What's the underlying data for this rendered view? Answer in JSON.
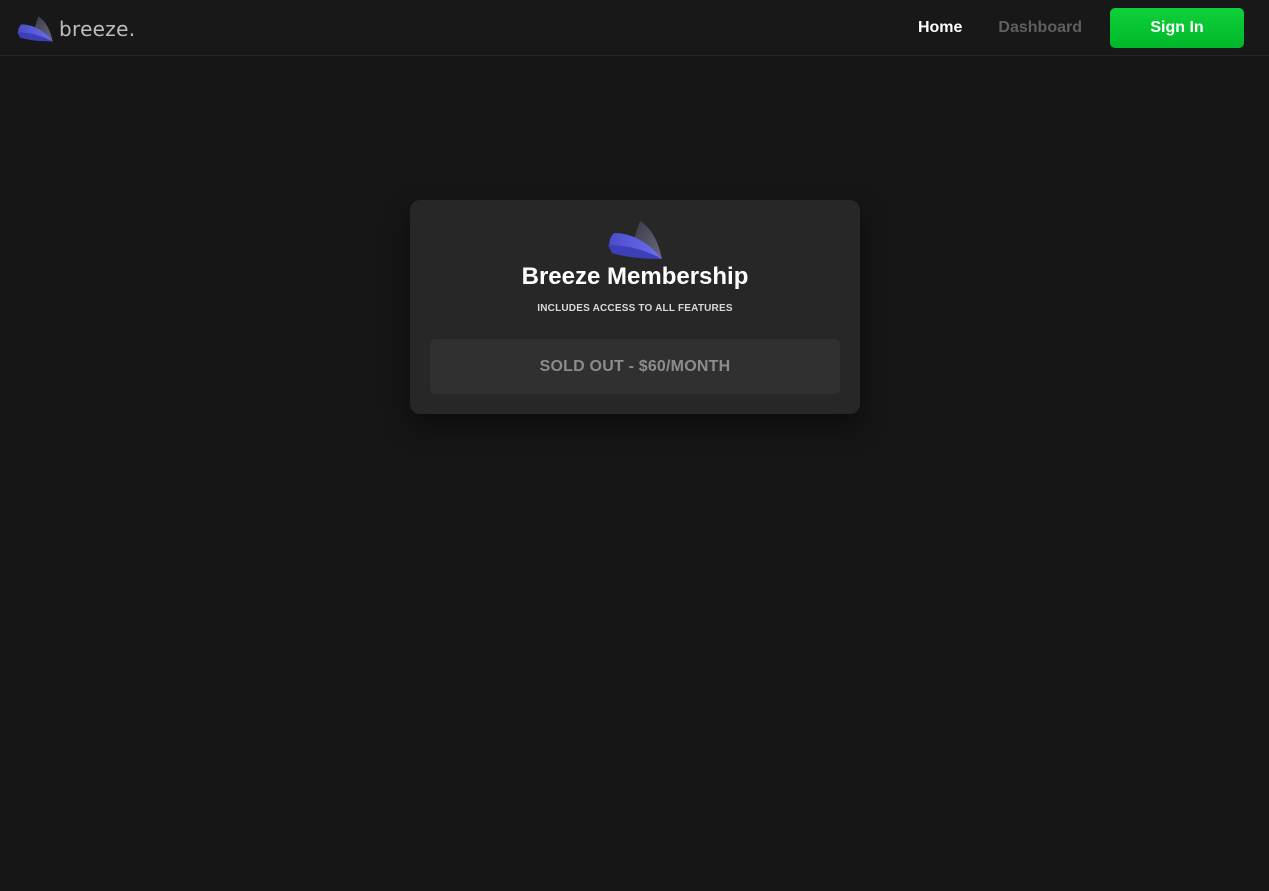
{
  "app": {
    "brand_name": "breeze.",
    "logo_icon": "breeze-wing-logo"
  },
  "nav": {
    "home_label": "Home",
    "dashboard_label": "Dashboard",
    "signin_label": "Sign In"
  },
  "membership": {
    "title": "Breeze Membership",
    "subtitle": "INCLUDES ACCESS TO ALL FEATURES",
    "status_button_label": "SOLD OUT - $60/MONTH"
  },
  "colors": {
    "background": "#161616",
    "card": "#272727",
    "accent_green": "#00c02e",
    "logo_purple": "#5b5ce6",
    "muted_text": "#8c8c8c"
  }
}
